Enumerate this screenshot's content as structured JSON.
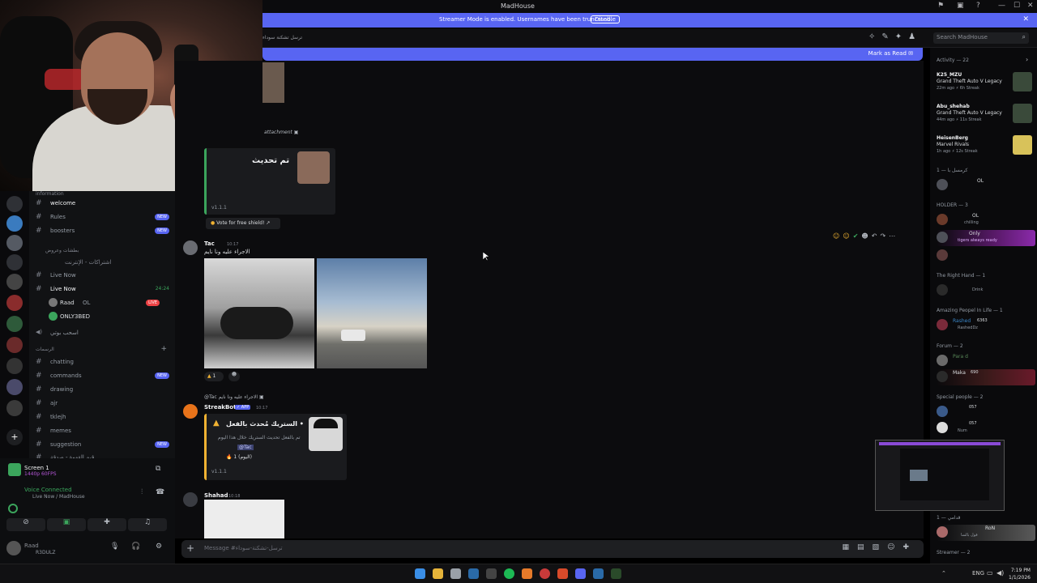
{
  "window": {
    "title": "MadHouse"
  },
  "streamer_bar": {
    "message": "Streamer Mode is enabled. Usernames have been truncated.",
    "disable_label": "Disable",
    "close": "✕"
  },
  "header": {
    "channel_name": "ترسل تشكنة سوداء",
    "search_placeholder": "Search MadHouse"
  },
  "new_bar": {
    "mark_read": "Mark as Read"
  },
  "channels": {
    "top_category": "information",
    "items": [
      {
        "label": "welcome",
        "badge": ""
      },
      {
        "label": "Rules",
        "badge": "NEW"
      },
      {
        "label": "boosters",
        "badge": "NEW"
      }
    ],
    "cat2": "بطشات وعروض",
    "cat2_sub": "اشتراكات - الإنترنت",
    "live_items": [
      {
        "label": "Live Now",
        "badge": ""
      },
      {
        "label": "Live Now",
        "badge": "24:24"
      }
    ],
    "voice_users": [
      {
        "name": "Raad",
        "tag": "OL",
        "badge": "LIVE"
      },
      {
        "name": "ONLY3BED",
        "tag": "",
        "badge": ""
      }
    ],
    "voice_extra": "اسحب بوتي",
    "cat3": "الرسمات",
    "text_items": [
      {
        "label": "chatting",
        "badge": ""
      },
      {
        "label": "commands",
        "badge": "NEW"
      },
      {
        "label": "drawing",
        "badge": ""
      },
      {
        "label": "ajr",
        "badge": ""
      },
      {
        "label": "tklejh",
        "badge": ""
      },
      {
        "label": "memes",
        "badge": ""
      },
      {
        "label": "suggestion",
        "badge": "NEW"
      }
    ],
    "bottom_partial": "قيم القهوة - صدقة"
  },
  "user_panel": {
    "screen": "Screen 1",
    "screen_sub": "1440p 60FPS",
    "voice_status": "Voice Connected",
    "voice_channel": "Live Now / MadHouse",
    "username": "Raad",
    "user_tag": "R3DULZ"
  },
  "chat": {
    "attachment_text": "attachment",
    "embed1": {
      "title": "تم تحديث",
      "version": "v1.1.1",
      "vote": "Vote for free shield!"
    },
    "msg_tac": {
      "name": "Tac",
      "time": "10:17",
      "text": "الاجراء عليه ونا نايم",
      "reaction_count": "1"
    },
    "msg_streak": {
      "reply": "@Tac الاجراء عليه ونا نايم",
      "name": "StreakBot",
      "app_tag": "APP",
      "time": "10:17",
      "title": "الستريك مُحدث بالفعل •",
      "line1": "تم بالفعل تحديث الستريك خلال هذا اليوم",
      "mention": "@Tac",
      "streak": "1 (اليوم)",
      "version": "v1.1.1"
    },
    "msg_shahad": {
      "name": "Shahad",
      "time": "10:18"
    },
    "input_placeholder": "Message #ترسل-تشكنة-سوداء"
  },
  "members": {
    "activity_header": "Activity — 22",
    "activities": [
      {
        "user": "K25_MZU",
        "game": "Grand Theft Auto V Legacy",
        "meta": "22m ago  ⚡ 6h Streak"
      },
      {
        "user": "Abu_shehab",
        "game": "Grand Theft Auto V Legacy",
        "meta": "44m ago  ⚡ 11s Streak"
      },
      {
        "user": "HeisenBerg",
        "game": "Marvel Rivals",
        "meta": "1h ago  ⚡ 12s Streak"
      }
    ],
    "sections": [
      {
        "title": "كرمسل با — 1",
        "members": [
          {
            "name": "OL",
            "sub": ""
          }
        ]
      },
      {
        "title": "HOLDER — 3",
        "members": [
          {
            "name": "OL",
            "sub": "chilling"
          },
          {
            "name": "Only",
            "sub": "tigers always ready"
          },
          {
            "name": "",
            "sub": ""
          }
        ]
      },
      {
        "title": "The Right Hand — 1",
        "members": [
          {
            "name": "",
            "sub": "Drink"
          }
        ]
      },
      {
        "title": "Amazing Peopel In Life — 1",
        "members": [
          {
            "name": "Rashed",
            "sub": "RashedDz"
          }
        ]
      },
      {
        "title": "Forum — 2",
        "members": [
          {
            "name": "Para d",
            "sub": ""
          },
          {
            "name": "Maka",
            "sub": ""
          }
        ]
      },
      {
        "title": "Special people — 2",
        "members": [
          {
            "name": "",
            "sub": ""
          },
          {
            "name": "",
            "sub": "Num"
          }
        ]
      },
      {
        "title": "قدامي — 1",
        "members": [
          {
            "name": "RoN",
            "sub": "قول بالسا"
          }
        ]
      },
      {
        "title": "Streamer — 2",
        "members": []
      }
    ],
    "rashed_count": "6363",
    "maka_count": "690",
    "special1_count": "057",
    "special2_count": "057"
  },
  "taskbar": {
    "time": "7:19 PM",
    "date": "1/1/2026",
    "lang": "ENG"
  },
  "colors": {
    "accent": "#5865f2",
    "online": "#3ba55c",
    "live": "#ed4245"
  }
}
